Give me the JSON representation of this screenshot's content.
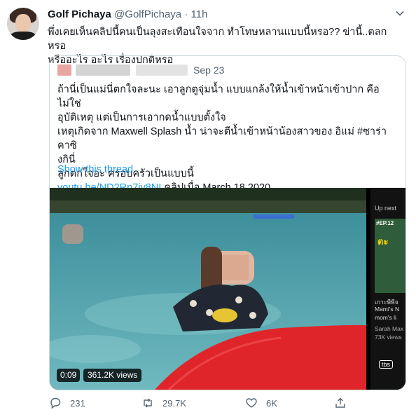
{
  "author": {
    "name": "Golf Pichaya",
    "handle": "@GolfPichaya",
    "separator": "·",
    "time": "11h"
  },
  "tweet_text": {
    "line1": "พึ่งเคยเห็นคลิปนี้คนเป็นลุงสะเทือนใจจาก ทำโทษหลานแบบนี้หรอ?? ข่านี้..ตลกหรอ",
    "line2": "หรืออะไร อะไร เรื่องปกติหรอ"
  },
  "quoted_tweet": {
    "date": "Sep 23",
    "lines": [
      "ถ้านี่เป็นแม่นี่ตกใจละนะ เอาลูกตูจุ่มน้ำ แบบแกล้งให้น้ำเข้าหน้าเข้าปาก คือไม่ใช่",
      "อุบัติเหตุ แต่เป็นการเอากดน้ำแบบตั้งใจ",
      "เหตุเกิดจาก Maxwell Splash น้ำ น่าจะตีน้ำเข้าหน้าน้องสาวของ อิแม่ #ซาร่าคาซิ",
      "งกินี่",
      "ลูกตกใจอะ ครอบครัวเป็นแบบนี้"
    ],
    "link": "youtu.be/ND2Rp7iy8NI",
    "link_suffix": "  คลิปเมื่อ March 18,2020",
    "show_thread": "Show this thread"
  },
  "video": {
    "duration": "0:09",
    "views": "361.2K views",
    "up_next": {
      "label": "Up next",
      "episode": "#EP.12",
      "thumb_title": "ตะ",
      "side_lines": [
        "เกาะพีพีจ",
        "Mami's N",
        "mom's li",
        "Sarah Max",
        "73K views"
      ],
      "channel_logo": "tbs"
    }
  },
  "actions": {
    "replies": "231",
    "retweets": "29.7K",
    "likes": "6K"
  },
  "colors": {
    "text": "#0f1419",
    "secondary": "#536471",
    "link": "#1d9bf0",
    "border": "#cfd9de",
    "pool_water": "#4fa0a8",
    "float_red": "#e0252a"
  },
  "icons": [
    "caret-down-icon",
    "reply-icon",
    "retweet-icon",
    "like-icon",
    "share-icon"
  ]
}
